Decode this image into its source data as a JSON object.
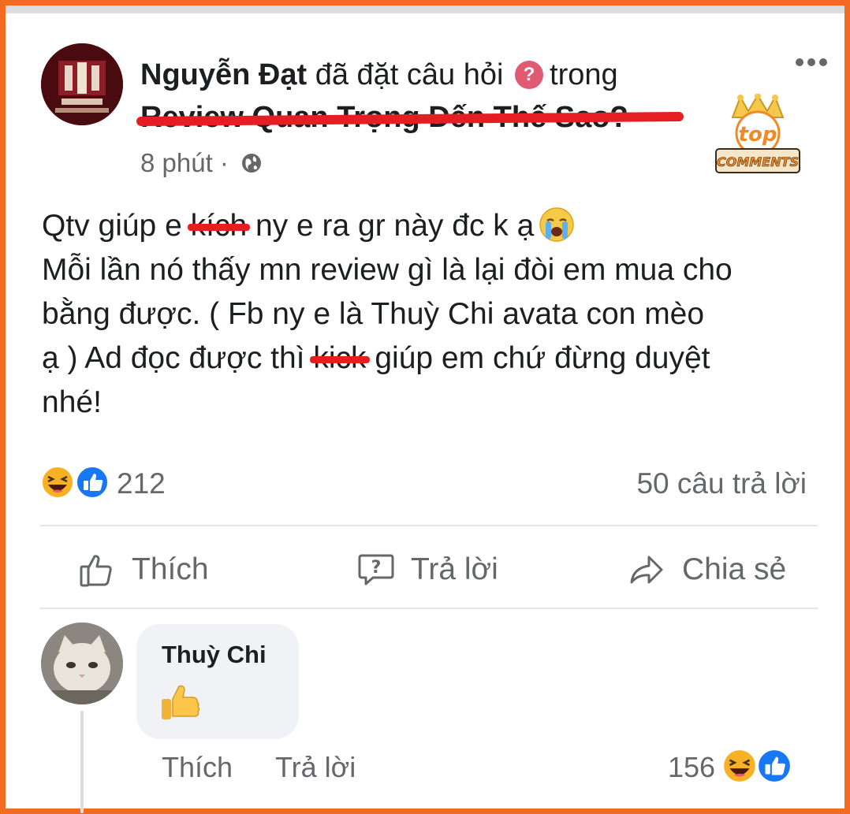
{
  "post": {
    "author": "Nguyễn Đạt",
    "action_text": "đã đặt câu hỏi",
    "trailing_text": "trong",
    "group_name": "Review Quan Trọng Đến Thế Sao?",
    "time": "8 phút",
    "time_separator": "·",
    "privacy_icon": "globe-icon",
    "body": {
      "line1_a": "Qtv giúp e ",
      "line1_struck": "kích",
      "line1_b": " ny e ra gr này đc k ạ",
      "line2": "Mỗi lần nó thấy mn review gì là lại đòi em mua cho",
      "line3": "bằng được. ( Fb ny e là Thuỳ Chi avata con mèo",
      "line4_a": "ạ ) Ad đọc được thì ",
      "line4_struck": "kick",
      "line4_b": " giúp em chứ đừng duyệt",
      "line5": "nhé!"
    },
    "reaction_count": "212",
    "reply_count": "50 câu trả lời"
  },
  "actions": {
    "like": "Thích",
    "reply": "Trả lời",
    "share": "Chia sẻ"
  },
  "comment": {
    "author": "Thuỳ Chi",
    "content_icon": "thumbs-up-emoji",
    "like": "Thích",
    "reply": "Trả lời",
    "reaction_count": "156"
  },
  "badge": {
    "line1": "top",
    "line2": "COMMENTS"
  },
  "colors": {
    "frame": "#f26b21",
    "strike": "#e51e24",
    "like_blue": "#1877f2",
    "haha_yellow": "#f7b125",
    "secondary_text": "#65676b"
  }
}
